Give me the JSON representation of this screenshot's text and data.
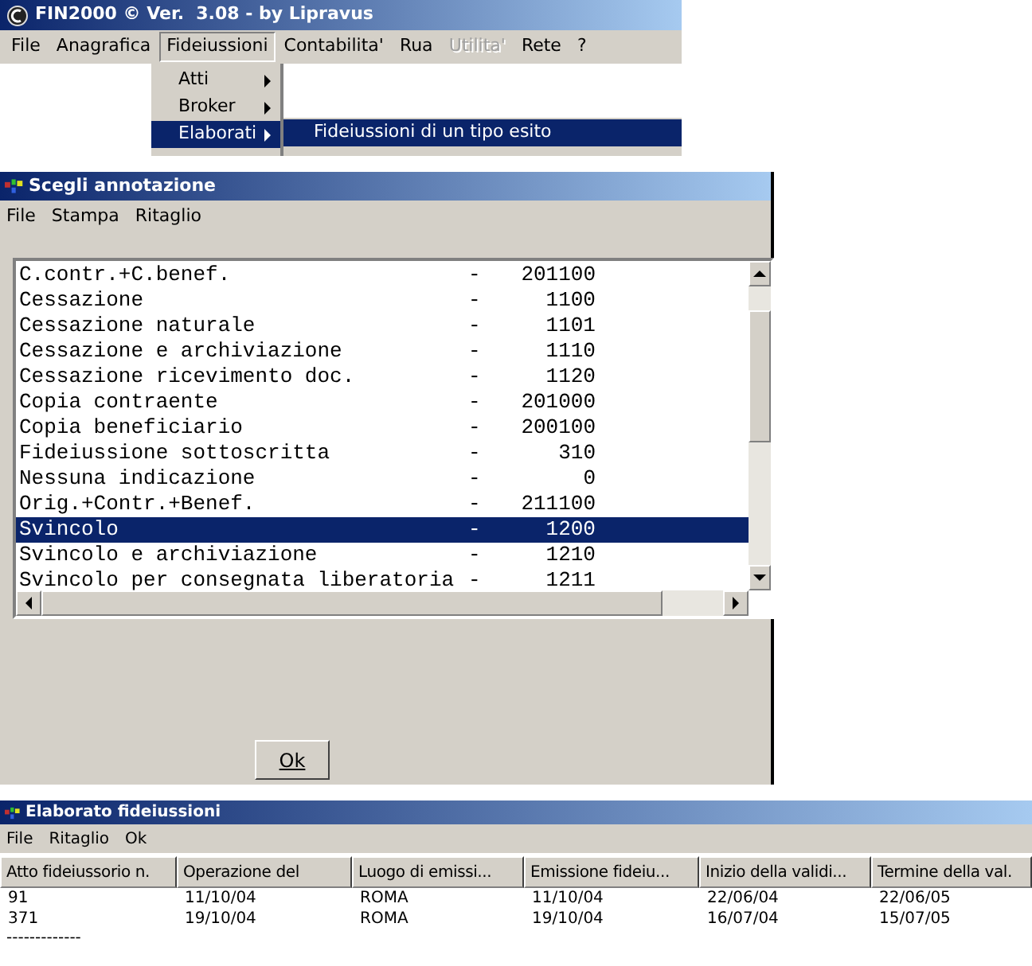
{
  "main_window": {
    "title": "FIN2000 © Ver.  3.08 - by Lipravus",
    "menu": [
      {
        "label": "File",
        "selected": false,
        "disabled": false
      },
      {
        "label": "Anagrafica",
        "selected": false,
        "disabled": false
      },
      {
        "label": "Fideiussioni",
        "selected": true,
        "disabled": false
      },
      {
        "label": "Contabilita'",
        "selected": false,
        "disabled": false
      },
      {
        "label": "Rua",
        "selected": false,
        "disabled": false
      },
      {
        "label": "Utilita'",
        "selected": false,
        "disabled": true
      },
      {
        "label": "Rete",
        "selected": false,
        "disabled": false
      },
      {
        "label": "?",
        "selected": false,
        "disabled": false
      }
    ],
    "dropdown": [
      {
        "label": "Atti",
        "selected": false
      },
      {
        "label": "Broker",
        "selected": false
      },
      {
        "label": "Elaborati",
        "selected": true
      }
    ],
    "submenu": [
      {
        "label": "Fideiussioni di un tipo esito",
        "selected": true
      }
    ]
  },
  "annotation_dialog": {
    "title": "Scegli annotazione",
    "menu": [
      "File",
      "Stampa",
      "Ritaglio"
    ],
    "list": [
      {
        "name": "C.contr.+C.benef.",
        "separator": "-",
        "code": "201100",
        "selected": false
      },
      {
        "name": "Cessazione",
        "separator": "-",
        "code": "1100",
        "selected": false
      },
      {
        "name": "Cessazione naturale",
        "separator": "-",
        "code": "1101",
        "selected": false
      },
      {
        "name": "Cessazione e archiviazione",
        "separator": "-",
        "code": "1110",
        "selected": false
      },
      {
        "name": "Cessazione ricevimento doc.",
        "separator": "-",
        "code": "1120",
        "selected": false
      },
      {
        "name": "Copia contraente",
        "separator": "-",
        "code": "201000",
        "selected": false
      },
      {
        "name": "Copia beneficiario",
        "separator": "-",
        "code": "200100",
        "selected": false
      },
      {
        "name": "Fideiussione sottoscritta",
        "separator": "-",
        "code": "310",
        "selected": false
      },
      {
        "name": "Nessuna indicazione",
        "separator": "-",
        "code": "0",
        "selected": false
      },
      {
        "name": "Orig.+Contr.+Benef.",
        "separator": "-",
        "code": "211100",
        "selected": false
      },
      {
        "name": "Svincolo",
        "separator": "-",
        "code": "1200",
        "selected": true
      },
      {
        "name": "Svincolo e archiviazione",
        "separator": "-",
        "code": "1210",
        "selected": false
      },
      {
        "name": "Svincolo per consegnata liberatoria",
        "separator": "-",
        "code": "1211",
        "selected": false
      }
    ],
    "ok_button": "Ok"
  },
  "report_window": {
    "title": "Elaborato fideiussioni",
    "menu": [
      "File",
      "Ritaglio",
      "Ok"
    ],
    "table": {
      "columns": [
        "Atto fideiussorio n.",
        "Operazione del",
        "Luogo di emissi...",
        "Emissione fideiu...",
        "Inizio della validi...",
        "Termine della val."
      ],
      "rows": [
        [
          "91",
          "11/10/04",
          "ROMA",
          "11/10/04",
          "22/06/04",
          "22/06/05"
        ],
        [
          "371",
          "19/10/04",
          "ROMA",
          "19/10/04",
          "16/07/04",
          "15/07/05"
        ]
      ]
    },
    "footer_rule": "-------------"
  }
}
